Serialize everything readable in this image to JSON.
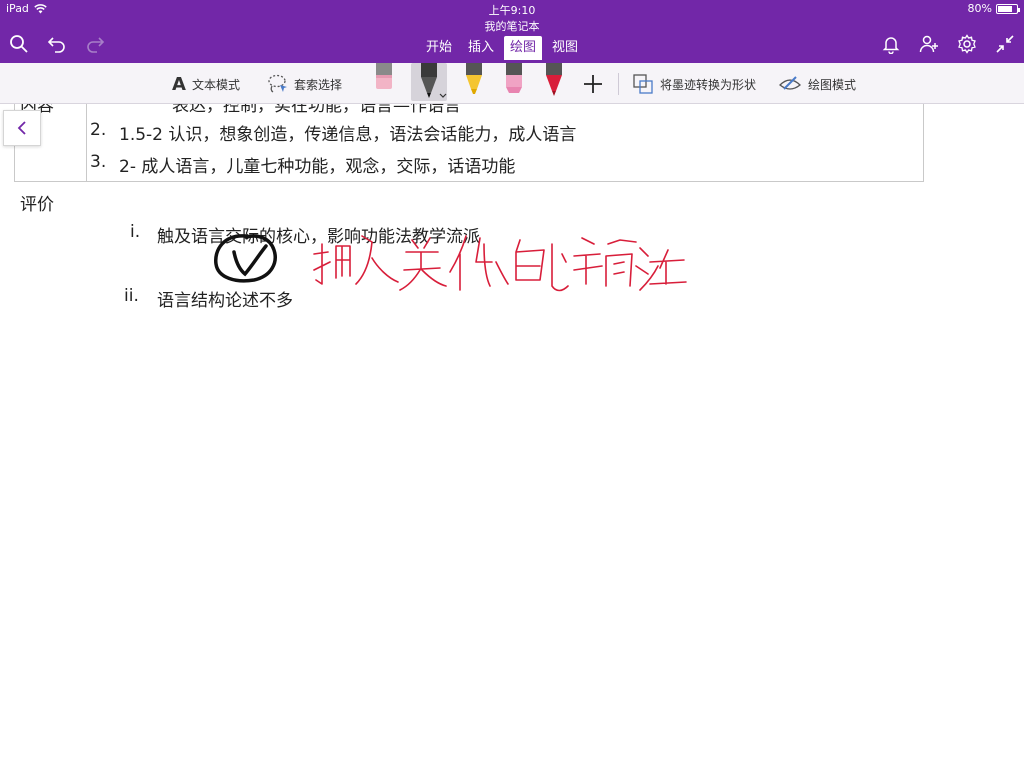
{
  "status": {
    "device": "iPad",
    "time": "上午9:10",
    "battery": "80%",
    "battery_level": 0.8
  },
  "notebook_title": "我的笔记本",
  "header": {
    "icons": [
      "search-icon",
      "undo-icon",
      "redo-icon",
      "bell-icon",
      "add-person-icon",
      "gear-icon",
      "collapse-icon"
    ],
    "tabs": [
      {
        "label": "开始",
        "active": false
      },
      {
        "label": "插入",
        "active": false
      },
      {
        "label": "绘图",
        "active": true
      },
      {
        "label": "视图",
        "active": false
      }
    ]
  },
  "ribbon": {
    "text_mode": "文本模式",
    "lasso_select": "套索选择",
    "ink_to_shape": "将墨迹转换为形状",
    "draw_mode": "绘图模式",
    "tools": [
      "eraser",
      "black-pen",
      "yellow-highlighter",
      "pink-highlighter",
      "red-pen",
      "add-pen"
    ]
  },
  "content": {
    "clipped_row": "表达，控制，实在功能，语言—作语言",
    "clipped_label": "内容",
    "rows": [
      {
        "num": "2.",
        "text": "1.5-2 认识，想象创造，传递信息，语法会话能力，成人语言"
      },
      {
        "num": "3.",
        "text": "2- 成人语言，儿童七种功能，观念，交际，话语功能"
      }
    ],
    "section_title": "评价",
    "items": [
      {
        "num": "i.",
        "text": "触及语言交际的核心，影响功能法教学流派"
      },
      {
        "num": "ii.",
        "text": "语言结构论述不多"
      }
    ]
  },
  "ink": {
    "annotation": "插入类似的箭头",
    "colors": {
      "circle": "#111111",
      "handwriting": "#d81e3a"
    }
  },
  "colors": {
    "accent": "#7227a8",
    "ribbon": "#f6f4f8"
  }
}
